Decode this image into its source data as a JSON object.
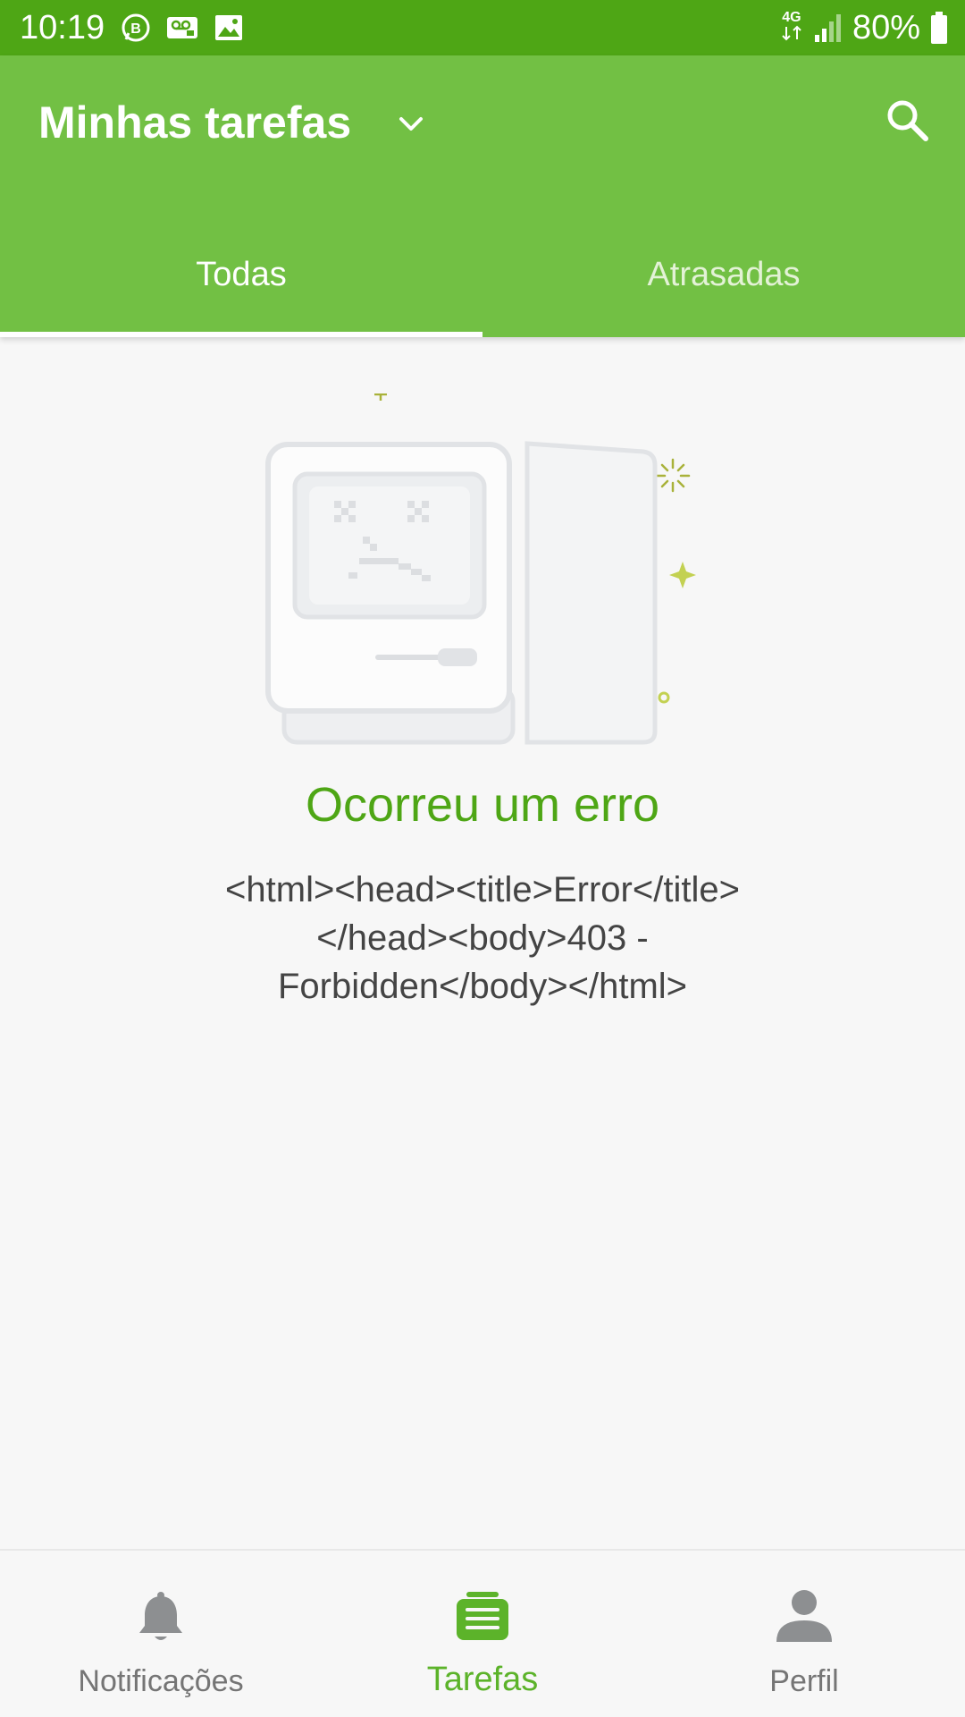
{
  "status_bar": {
    "time": "10:19",
    "network": "4G",
    "battery": "80%"
  },
  "app_bar": {
    "title": "Minhas tarefas",
    "tabs": [
      {
        "label": "Todas",
        "active": true
      },
      {
        "label": "Atrasadas",
        "active": false
      }
    ]
  },
  "error": {
    "title": "Ocorreu um erro",
    "message": "<html><head><title>Error</title></head><body>403 - Forbidden</body></html>"
  },
  "bottom_nav": {
    "items": [
      {
        "label": "Notificações",
        "icon": "bell-icon",
        "active": false
      },
      {
        "label": "Tarefas",
        "icon": "tasks-icon",
        "active": true
      },
      {
        "label": "Perfil",
        "icon": "person-icon",
        "active": false
      }
    ]
  },
  "colors": {
    "status_bar": "#4ea615",
    "app_bar": "#72c044",
    "accent": "#5cb32a",
    "error_title": "#4ea615",
    "inactive": "#757575"
  }
}
